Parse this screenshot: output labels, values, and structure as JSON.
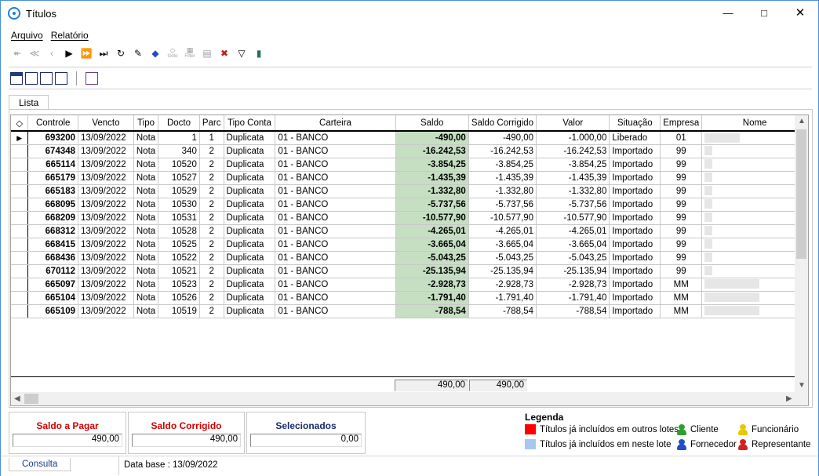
{
  "window": {
    "title": "Títulos"
  },
  "menu": [
    "Arquivo",
    "Relatório"
  ],
  "toolbar": {
    "goto_label": "Goto",
    "filter_label": "Filter"
  },
  "tabs": {
    "main": "Lista"
  },
  "grid": {
    "columns": [
      "Controle",
      "Vencto",
      "Tipo",
      "Docto",
      "Parc",
      "Tipo Conta",
      "Carteira",
      "Saldo",
      "Saldo Corrigido",
      "Valor",
      "Situação",
      "Empresa",
      "Nome"
    ],
    "rows": [
      [
        "693200",
        "13/09/2022",
        "Nota",
        "1",
        "1",
        "Duplicata",
        "01 - BANCO",
        "-490,00",
        "-490,00",
        "-1.000,00",
        "Liberado",
        "01"
      ],
      [
        "674348",
        "13/09/2022",
        "Nota",
        "340",
        "2",
        "Duplicata",
        "01 - BANCO",
        "-16.242,53",
        "-16.242,53",
        "-16.242,53",
        "Importado",
        "99"
      ],
      [
        "665114",
        "13/09/2022",
        "Nota",
        "10520",
        "2",
        "Duplicata",
        "01 - BANCO",
        "-3.854,25",
        "-3.854,25",
        "-3.854,25",
        "Importado",
        "99"
      ],
      [
        "665179",
        "13/09/2022",
        "Nota",
        "10527",
        "2",
        "Duplicata",
        "01 - BANCO",
        "-1.435,39",
        "-1.435,39",
        "-1.435,39",
        "Importado",
        "99"
      ],
      [
        "665183",
        "13/09/2022",
        "Nota",
        "10529",
        "2",
        "Duplicata",
        "01 - BANCO",
        "-1.332,80",
        "-1.332,80",
        "-1.332,80",
        "Importado",
        "99"
      ],
      [
        "668095",
        "13/09/2022",
        "Nota",
        "10530",
        "2",
        "Duplicata",
        "01 - BANCO",
        "-5.737,56",
        "-5.737,56",
        "-5.737,56",
        "Importado",
        "99"
      ],
      [
        "668209",
        "13/09/2022",
        "Nota",
        "10531",
        "2",
        "Duplicata",
        "01 - BANCO",
        "-10.577,90",
        "-10.577,90",
        "-10.577,90",
        "Importado",
        "99"
      ],
      [
        "668312",
        "13/09/2022",
        "Nota",
        "10528",
        "2",
        "Duplicata",
        "01 - BANCO",
        "-4.265,01",
        "-4.265,01",
        "-4.265,01",
        "Importado",
        "99"
      ],
      [
        "668415",
        "13/09/2022",
        "Nota",
        "10525",
        "2",
        "Duplicata",
        "01 - BANCO",
        "-3.665,04",
        "-3.665,04",
        "-3.665,04",
        "Importado",
        "99"
      ],
      [
        "668436",
        "13/09/2022",
        "Nota",
        "10522",
        "2",
        "Duplicata",
        "01 - BANCO",
        "-5.043,25",
        "-5.043,25",
        "-5.043,25",
        "Importado",
        "99"
      ],
      [
        "670112",
        "13/09/2022",
        "Nota",
        "10521",
        "2",
        "Duplicata",
        "01 - BANCO",
        "-25.135,94",
        "-25.135,94",
        "-25.135,94",
        "Importado",
        "99"
      ],
      [
        "665097",
        "13/09/2022",
        "Nota",
        "10523",
        "2",
        "Duplicata",
        "01 - BANCO",
        "-2.928,73",
        "-2.928,73",
        "-2.928,73",
        "Importado",
        "MM"
      ],
      [
        "665104",
        "13/09/2022",
        "Nota",
        "10526",
        "2",
        "Duplicata",
        "01 - BANCO",
        "-1.791,40",
        "-1.791,40",
        "-1.791,40",
        "Importado",
        "MM"
      ],
      [
        "665109",
        "13/09/2022",
        "Nota",
        "10519",
        "2",
        "Duplicata",
        "01 - BANCO",
        "-788,54",
        "-788,54",
        "-788,54",
        "Importado",
        "MM"
      ]
    ],
    "totals": {
      "saldo": "490,00",
      "saldo_corrigido": "490,00"
    }
  },
  "summary": {
    "saldo_pagar": {
      "label": "Saldo a Pagar",
      "value": "490,00"
    },
    "saldo_corrigido": {
      "label": "Saldo Corrigido",
      "value": "490,00"
    },
    "selecionados": {
      "label": "Selecionados",
      "value": "0,00"
    }
  },
  "legend": {
    "title": "Legenda",
    "items": [
      {
        "label": "Títulos já incluídos em outros lotes",
        "color": "#ff0000"
      },
      {
        "label": "Títulos já incluídos em neste lote",
        "color": "#a6c8f0"
      }
    ],
    "roles": [
      {
        "label": "Cliente",
        "color": "#2e9e2e"
      },
      {
        "label": "Funcionário",
        "color": "#e8c800"
      },
      {
        "label": "Fornecedor",
        "color": "#1e4fc8"
      },
      {
        "label": "Representante",
        "color": "#d42020"
      }
    ]
  },
  "status": {
    "tab": "Consulta",
    "text": "Data base : 13/09/2022"
  }
}
